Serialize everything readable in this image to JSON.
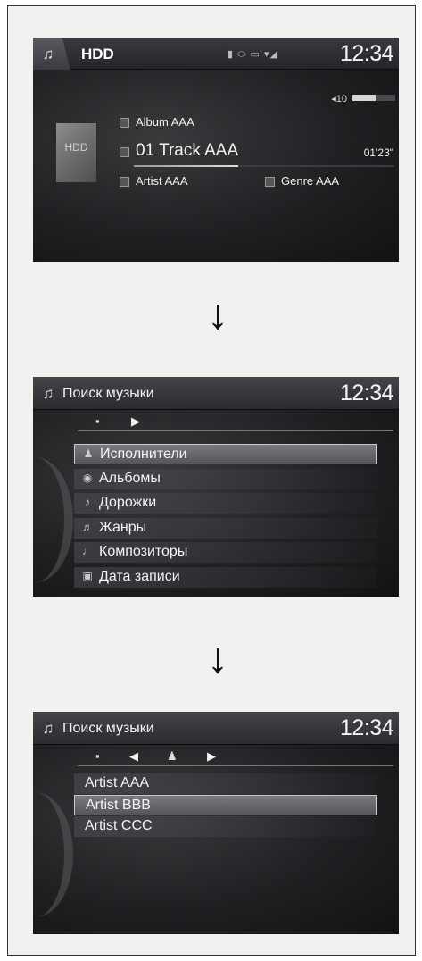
{
  "screen1": {
    "source": "HDD",
    "status_icons": "▮ ⬭ ▭ ▾◢",
    "clock": "12:34",
    "volume": {
      "label": "◂10",
      "level": 0.55
    },
    "hdd_label": "HDD",
    "album": "Album AAA",
    "track": "01 Track AAA",
    "time": "01'23\"",
    "artist": "Artist AAA",
    "genre": "Genre AAA",
    "progress": 0.4,
    "icons": {
      "source": "music-note-icon"
    }
  },
  "screen2": {
    "title": "Поиск музыки",
    "clock": "12:34",
    "items": [
      {
        "label": "Исполнители",
        "icon": "♟"
      },
      {
        "label": "Альбомы",
        "icon": "◉"
      },
      {
        "label": "Дорожки",
        "icon": "♪"
      },
      {
        "label": "Жанры",
        "icon": "♬"
      },
      {
        "label": "Композиторы",
        "icon": "♩"
      },
      {
        "label": "Дата записи",
        "icon": "▣"
      }
    ],
    "selected_index": 0
  },
  "screen3": {
    "title": "Поиск музыки",
    "clock": "12:34",
    "items": [
      {
        "label": "Artist AAA"
      },
      {
        "label": "Artist BBB"
      },
      {
        "label": "Artist CCC"
      }
    ],
    "selected_index": 1
  },
  "arrows": {
    "glyph": "↓"
  }
}
